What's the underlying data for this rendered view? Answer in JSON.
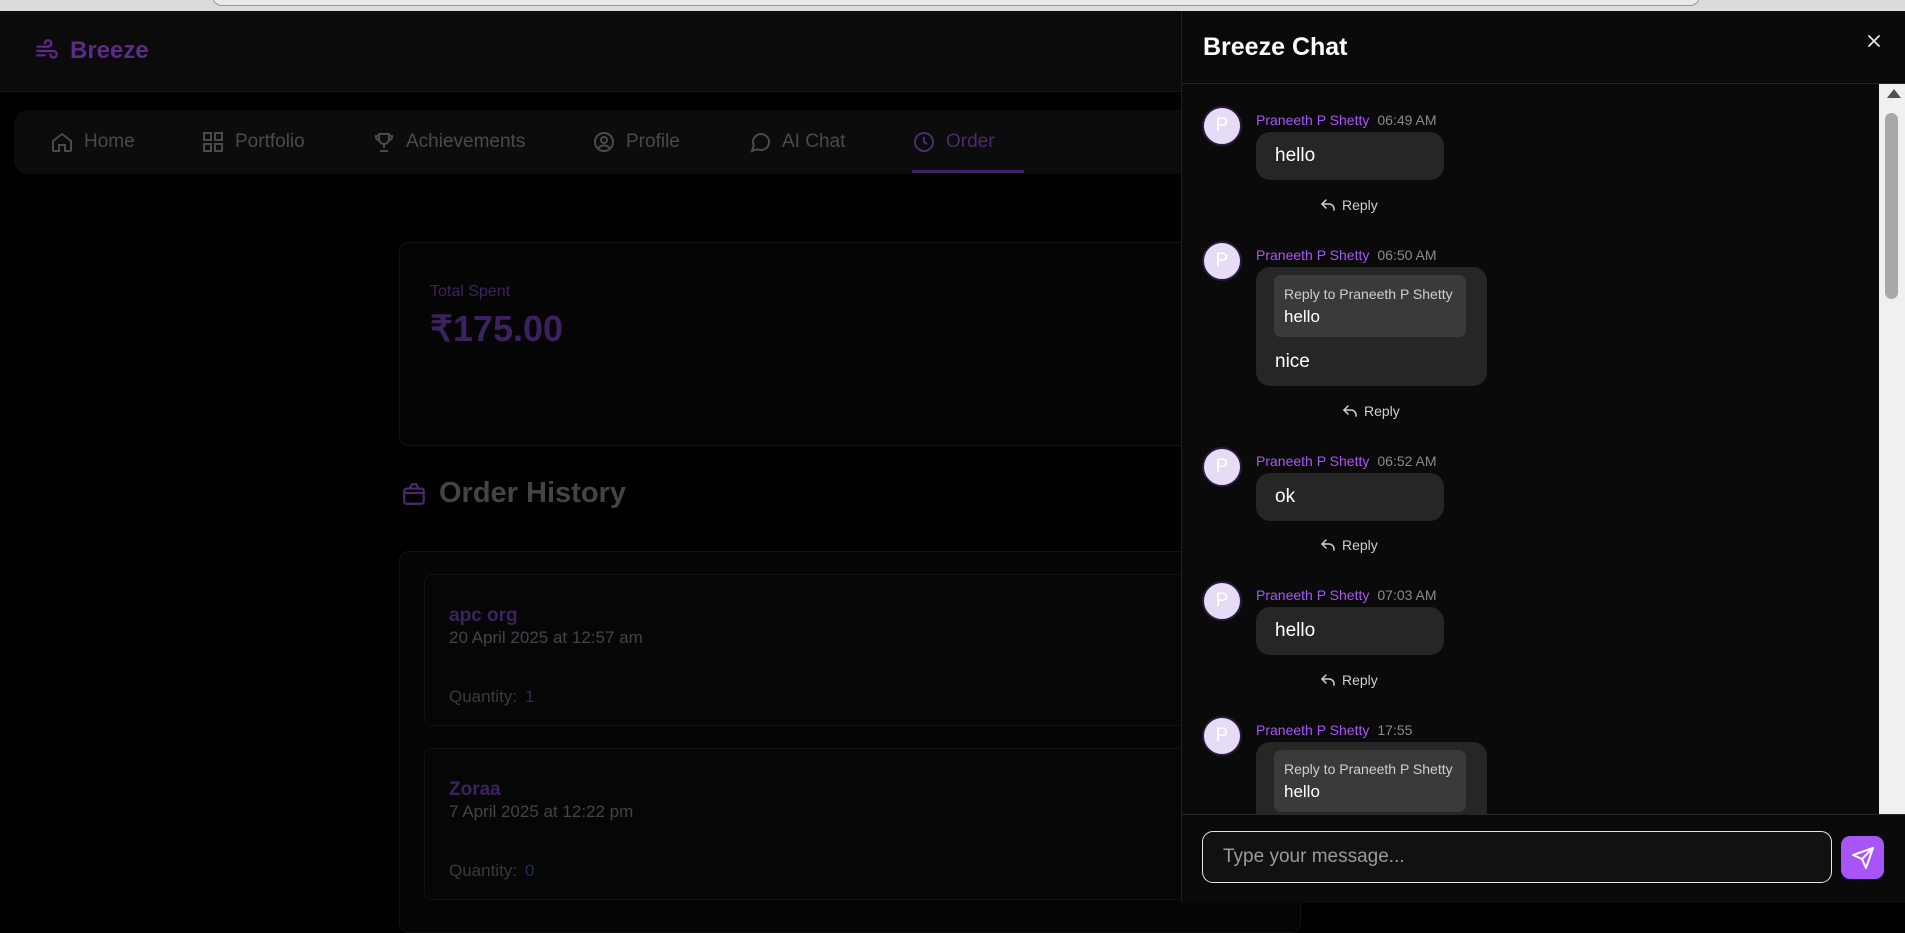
{
  "app": {
    "brand": "Breeze",
    "nav": [
      {
        "label": "Home",
        "icon": "home-icon"
      },
      {
        "label": "Portfolio",
        "icon": "grid-icon"
      },
      {
        "label": "Achievements",
        "icon": "trophy-icon"
      },
      {
        "label": "Profile",
        "icon": "user-circle-icon"
      },
      {
        "label": "AI Chat",
        "icon": "chat-bubble-icon"
      },
      {
        "label": "Order",
        "icon": "clock-icon",
        "active": true
      }
    ],
    "spent": {
      "label": "Total Spent",
      "value": "₹175.00"
    },
    "history_title": "Order History",
    "orders": [
      {
        "name": "apc org",
        "date": "20 April 2025 at 12:57 am",
        "qty_label": "Quantity:",
        "qty": "1"
      },
      {
        "name": "Zoraa",
        "date": "7 April 2025 at 12:22 pm",
        "qty_label": "Quantity:",
        "qty": "0"
      }
    ]
  },
  "chat": {
    "title": "Breeze Chat",
    "reply_label": "Reply",
    "input_placeholder": "Type your message...",
    "messages": [
      {
        "avatar": "P",
        "author": "Praneeth P Shetty",
        "time": "06:49 AM",
        "text": "hello"
      },
      {
        "avatar": "P",
        "author": "Praneeth P Shetty",
        "time": "06:50 AM",
        "reply_to": "Reply to Praneeth P Shetty",
        "quoted": "hello",
        "text": "nice"
      },
      {
        "avatar": "P",
        "author": "Praneeth P Shetty",
        "time": "06:52 AM",
        "text": "ok"
      },
      {
        "avatar": "P",
        "author": "Praneeth P Shetty",
        "time": "07:03 AM",
        "text": "hello"
      },
      {
        "avatar": "P",
        "author": "Praneeth P Shetty",
        "time": "17:55",
        "reply_to": "Reply to Praneeth P Shetty",
        "quoted": "hello"
      }
    ]
  },
  "colors": {
    "accent": "#a855f7",
    "panel": "#0a0a0a",
    "bubble": "#262626"
  }
}
